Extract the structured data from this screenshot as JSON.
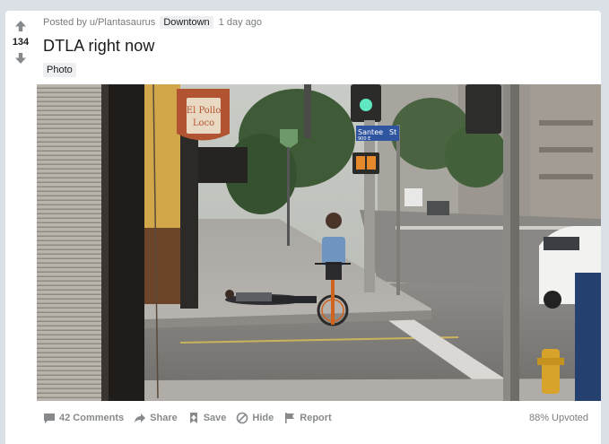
{
  "post": {
    "score": "134",
    "posted_by_prefix": "Posted by",
    "author": "u/Plantasaurus",
    "flair": "Downtown",
    "time": "1 day ago",
    "title": "DTLA right now",
    "tag": "Photo"
  },
  "image_text": {
    "shop_sign": "El Pollo Loco",
    "street_sign_name": "Santee",
    "street_sign_suffix": "St",
    "street_sign_block": "900 E"
  },
  "actions": {
    "comments": "42 Comments",
    "share": "Share",
    "save": "Save",
    "hide": "Hide",
    "report": "Report",
    "upvoted": "88% Upvoted"
  },
  "colors": {
    "page_bg": "#dae0e6",
    "card_bg": "#ffffff",
    "muted_text": "#878a8c"
  },
  "icons": [
    "upvote-icon",
    "downvote-icon",
    "comment-icon",
    "share-icon",
    "save-icon",
    "hide-icon",
    "report-icon"
  ]
}
